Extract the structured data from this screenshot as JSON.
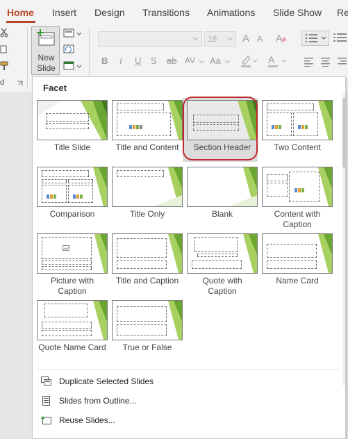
{
  "tabs": [
    "Home",
    "Insert",
    "Design",
    "Transitions",
    "Animations",
    "Slide Show",
    "Re"
  ],
  "ribbon": {
    "new_slide_line1": "New",
    "new_slide_line2": "Slide",
    "font_size": "18",
    "format_letters": [
      "B",
      "I",
      "U",
      "S",
      "ab",
      "AV",
      "Aa"
    ],
    "clipboard_label_fragment": "d"
  },
  "menu": {
    "header": "Facet",
    "layouts": [
      {
        "label": "Title Slide"
      },
      {
        "label": "Title and Content"
      },
      {
        "label": "Section Header",
        "selected": true
      },
      {
        "label": "Two Content"
      },
      {
        "label": "Comparison"
      },
      {
        "label": "Title Only"
      },
      {
        "label": "Blank"
      },
      {
        "label": "Content with Caption"
      },
      {
        "label": "Picture with Caption"
      },
      {
        "label": "Title and Caption"
      },
      {
        "label": "Quote with Caption"
      },
      {
        "label": "Name Card"
      },
      {
        "label": "Quote Name Card"
      },
      {
        "label": "True or False"
      }
    ],
    "commands": [
      {
        "label": "Duplicate Selected Slides",
        "icon": "duplicate-slides-icon"
      },
      {
        "label": "Slides from Outline...",
        "icon": "outline-document-icon"
      },
      {
        "label": "Reuse Slides...",
        "icon": "reuse-slides-icon"
      }
    ]
  },
  "colors": {
    "accent": "#b7472a",
    "selection_ring": "#c0272d",
    "facet_green": "#6aa632",
    "facet_light_green": "#a8d060",
    "facet_dark_green": "#3f7a1e"
  }
}
